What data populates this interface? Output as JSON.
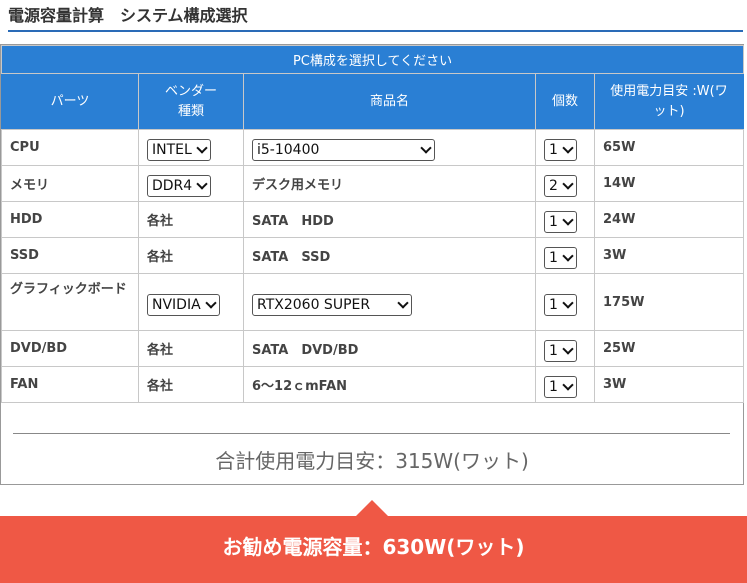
{
  "heading": "電源容量計算　システム構成選択",
  "table": {
    "caption": "PC構成を選択してください",
    "headers": {
      "part": "パーツ",
      "vendor_line1": "ベンダー",
      "vendor_line2": "種類",
      "product": "商品名",
      "qty": "個数",
      "power_line1": "使用電力目安 :W(ワ",
      "power_line2": "ット)"
    },
    "rows": [
      {
        "part": "CPU",
        "vendor": "INTEL",
        "vendor_select": true,
        "product": "i5-10400",
        "product_select": true,
        "qty": "1",
        "power": "65W"
      },
      {
        "part": "メモリ",
        "vendor": "DDR4",
        "vendor_select": true,
        "product": "デスク用メモリ",
        "product_select": false,
        "qty": "2",
        "power": "14W"
      },
      {
        "part": "HDD",
        "vendor": "各社",
        "vendor_select": false,
        "product": "SATA　HDD",
        "product_select": false,
        "qty": "1",
        "power": "24W"
      },
      {
        "part": "SSD",
        "vendor": "各社",
        "vendor_select": false,
        "product": "SATA　SSD",
        "product_select": false,
        "qty": "1",
        "power": "3W"
      },
      {
        "part": "グラフィックボード",
        "vendor": "NVIDIA",
        "vendor_select": true,
        "product": "RTX2060 SUPER",
        "product_select": true,
        "qty": "1",
        "power": "175W"
      },
      {
        "part": "DVD/BD",
        "vendor": "各社",
        "vendor_select": false,
        "product": "SATA　DVD/BD",
        "product_select": false,
        "qty": "1",
        "power": "25W"
      },
      {
        "part": "FAN",
        "vendor": "各社",
        "vendor_select": false,
        "product": "6～12ｃmFAN",
        "product_select": false,
        "qty": "1",
        "power": "3W"
      }
    ]
  },
  "total": "合計使用電力目安：315W(ワット)",
  "recommendation": "お勧め電源容量：630W(ワット)",
  "colors": {
    "header_blue": "#2a7fd4",
    "recommend_red": "#ef5845"
  }
}
